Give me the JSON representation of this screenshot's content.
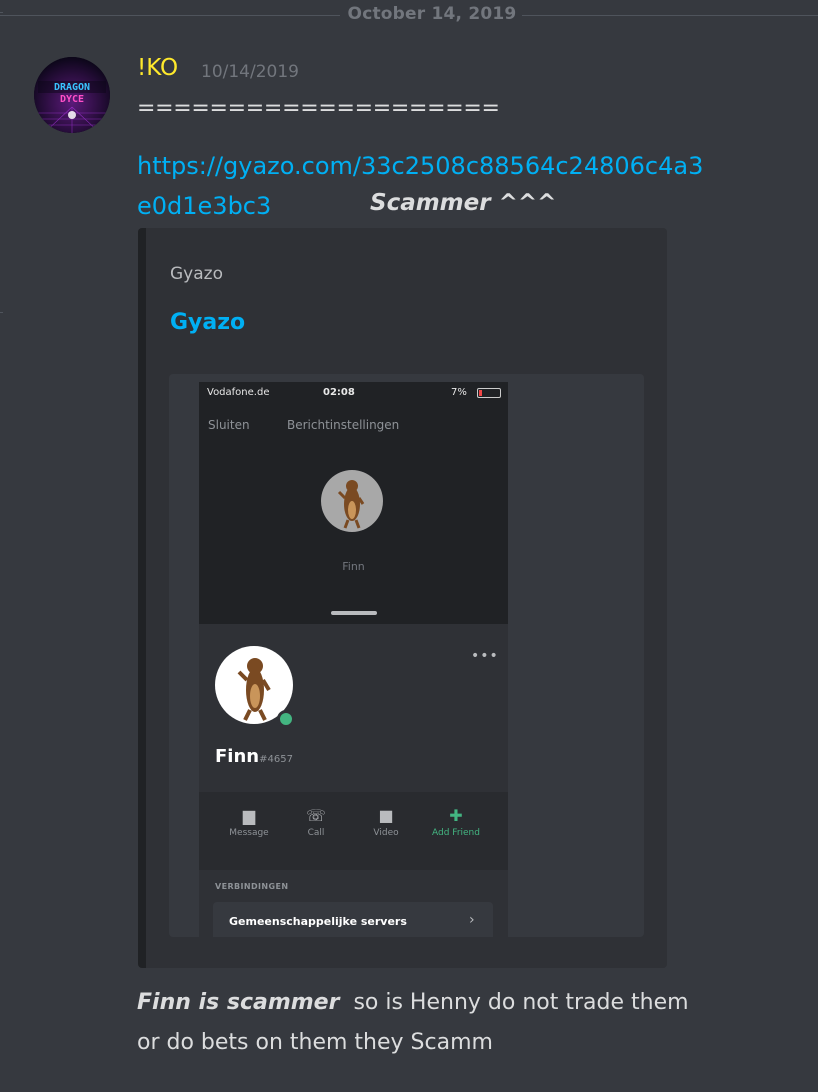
{
  "divider": {
    "date": "October 14, 2019"
  },
  "message": {
    "author": "!KO",
    "author_color": "#ffe92c",
    "timestamp": "10/14/2019",
    "separator_text": "====================",
    "link_line1": "https://gyazo.com/33c2508c88564c24806c4a3",
    "link_line2": "e0d1e3bc3",
    "link_color": "#00b0f4",
    "inline_emphasis": "Scammer ^^^",
    "avatar": {
      "icon": "dragon-dyce-avatar",
      "text_line1": "DRAGON",
      "text_line2": "DYCE"
    }
  },
  "embed": {
    "provider": "Gyazo",
    "title": "Gyazo",
    "screenshot": {
      "status_carrier": "Vodafone.de",
      "status_time": "02:08",
      "status_battery": "7%",
      "close_label": "Sluiten",
      "settings_label": "Berichtinstellingen",
      "small_name": "Finn",
      "username": "Finn",
      "discriminator": "#4657",
      "actions": [
        {
          "icon": "message-icon",
          "label": "Message"
        },
        {
          "icon": "call-icon",
          "label": "Call"
        },
        {
          "icon": "video-icon",
          "label": "Video"
        },
        {
          "icon": "add-friend-icon",
          "label": "Add Friend"
        }
      ],
      "section_label": "VERBINDINGEN",
      "mutual_servers_label": "Gemeenschappelijke servers"
    }
  },
  "followup": {
    "emphasis": "Finn is scammer",
    "text_line1": "so is Henny  do not trade them",
    "text_line2": "or do bets on them they Scamm"
  }
}
